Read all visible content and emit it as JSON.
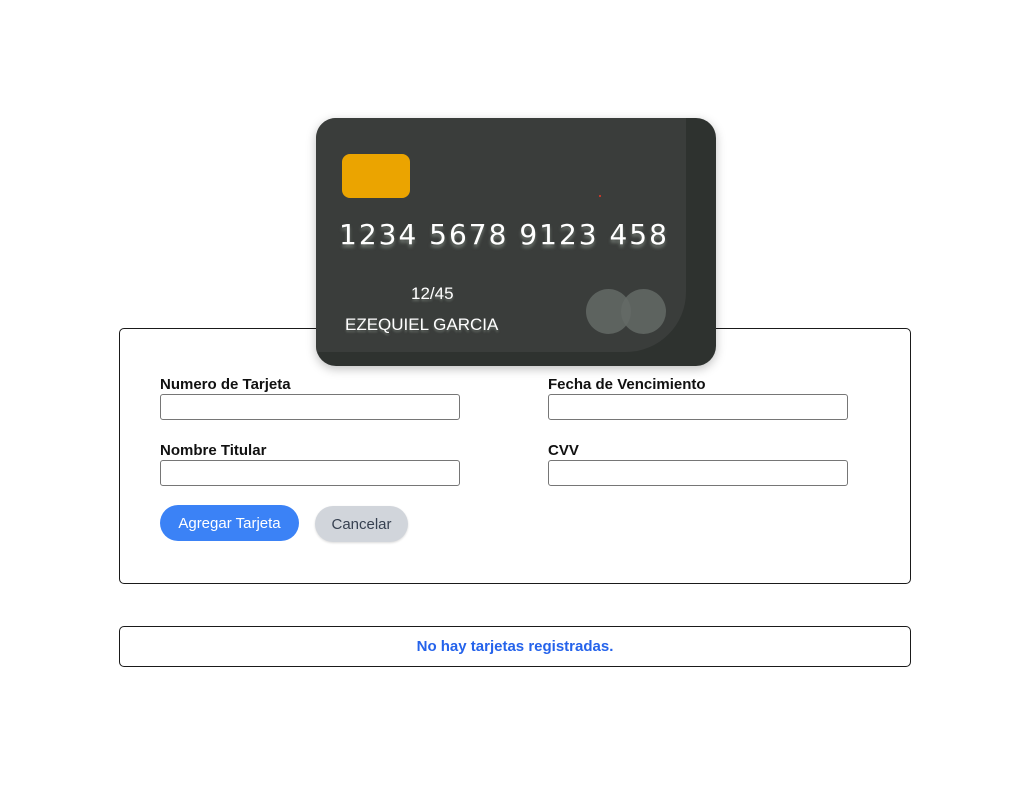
{
  "card": {
    "number": "1234 5678 9123 458",
    "expiry": "12/45",
    "holder": "EZEQUIEL GARCIA",
    "chip_color": "#eba400",
    "body_color": "#2e322f"
  },
  "form": {
    "card_number": {
      "label": "Numero de Tarjeta",
      "value": ""
    },
    "expiry": {
      "label": "Fecha de Vencimiento",
      "value": ""
    },
    "holder_name": {
      "label": "Nombre Titular",
      "value": ""
    },
    "cvv": {
      "label": "CVV",
      "value": ""
    },
    "submit_label": "Agregar Tarjeta",
    "cancel_label": "Cancelar",
    "primary_color": "#3b82f6"
  },
  "empty_state": {
    "message": "No hay tarjetas registradas.",
    "color": "#2563eb"
  }
}
